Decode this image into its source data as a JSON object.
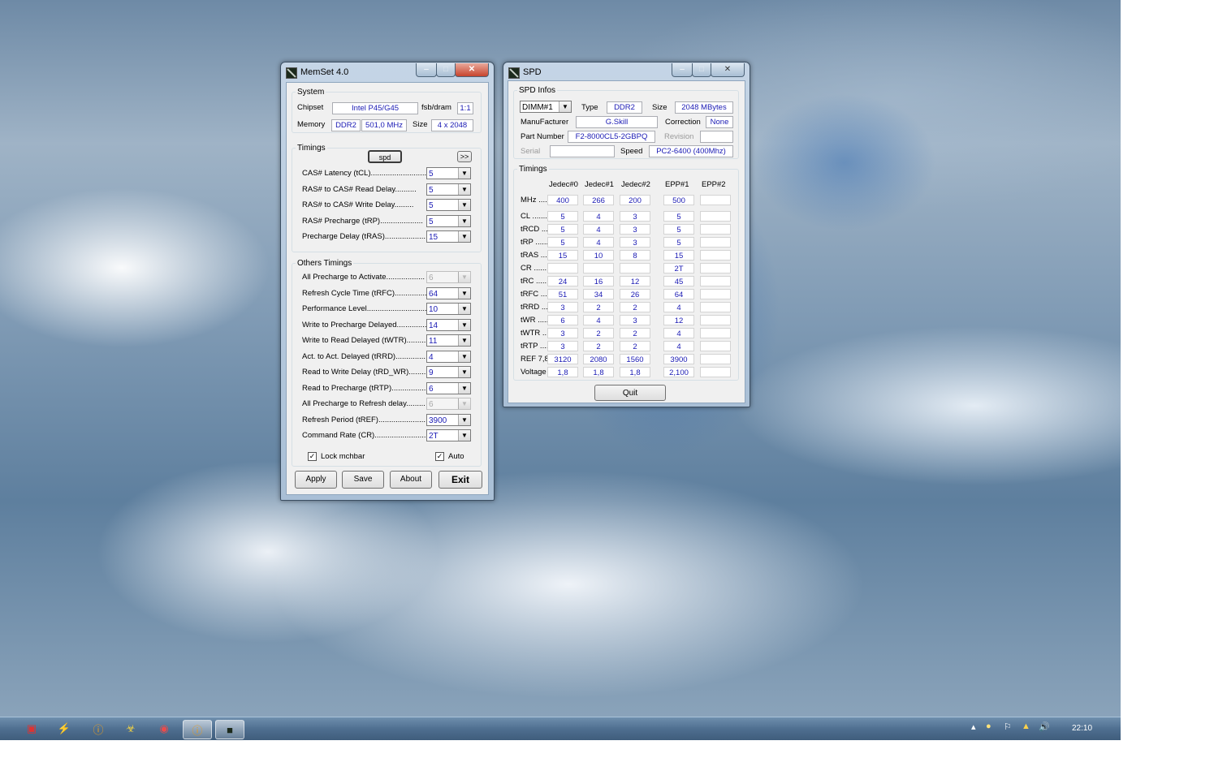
{
  "memset": {
    "title": "MemSet 4.0",
    "system": {
      "legend": "System",
      "chipset_label": "Chipset",
      "chipset_value": "Intel P45/G45",
      "fsbdram_label": "fsb/dram",
      "fsbdram_value": "1:1",
      "memory_label": "Memory",
      "memory_type": "DDR2",
      "memory_freq": "501,0 MHz",
      "size_label": "Size",
      "size_value": "4 x 2048"
    },
    "timings": {
      "legend": "Timings",
      "spd_button": "spd",
      "more_button": ">>",
      "rows": [
        {
          "label": "CAS# Latency (tCL)..........................",
          "value": "5"
        },
        {
          "label": "RAS# to CAS# Read Delay..........",
          "value": "5"
        },
        {
          "label": "RAS# to CAS# Write Delay.........",
          "value": "5"
        },
        {
          "label": "RAS# Precharge (tRP)....................",
          "value": "5"
        },
        {
          "label": "Precharge Delay  (tRAS)...................",
          "value": "15"
        }
      ]
    },
    "others": {
      "legend": "Others Timings",
      "rows": [
        {
          "label": "All Precharge to Activate..................",
          "value": "6",
          "disabled": true
        },
        {
          "label": "Refresh Cycle Time (tRFC)...............",
          "value": "64",
          "disabled": false
        },
        {
          "label": "Performance Level............................",
          "value": "10",
          "disabled": false
        },
        {
          "label": "Write to Precharge Delayed..............",
          "value": "14",
          "disabled": false
        },
        {
          "label": "Write to Read Delayed (tWTR).........",
          "value": "11",
          "disabled": false
        },
        {
          "label": "Act. to Act. Delayed (tRRD)..............",
          "value": "4",
          "disabled": false
        },
        {
          "label": "Read to Write Delay (tRD_WR).........",
          "value": "9",
          "disabled": false
        },
        {
          "label": "Read to Precharge (tRTP)................",
          "value": "6",
          "disabled": false
        },
        {
          "label": "All Precharge to Refresh delay.........",
          "value": "6",
          "disabled": true
        },
        {
          "label": "Refresh Period (tREF)......................",
          "value": "3900",
          "disabled": false
        },
        {
          "label": "Command Rate (CR)..........................",
          "value": "2T",
          "disabled": false
        }
      ],
      "lock_mchbar": "Lock mchbar",
      "auto": "Auto"
    },
    "buttons": {
      "apply": "Apply",
      "save": "Save",
      "about": "About",
      "exit": "Exit"
    }
  },
  "spd": {
    "title": "SPD",
    "infos": {
      "legend": "SPD Infos",
      "dimm": "DIMM#1",
      "type_label": "Type",
      "type_value": "DDR2",
      "size_label": "Size",
      "size_value": "2048 MBytes",
      "manufacturer_label": "ManuFacturer",
      "manufacturer_value": "G.Skill",
      "correction_label": "Correction",
      "correction_value": "None",
      "partnumber_label": "Part Number",
      "partnumber_value": "F2-8000CL5-2GBPQ",
      "revision_label": "Revision",
      "serial_label": "Serial",
      "speed_label": "Speed",
      "speed_value": "PC2-6400 (400Mhz)"
    },
    "timings": {
      "legend": "Timings",
      "columns": [
        "Jedec#0",
        "Jedec#1",
        "Jedec#2",
        "EPP#1",
        "EPP#2"
      ],
      "rows": [
        {
          "label": "MHz .....",
          "values": [
            "400",
            "266",
            "200",
            "500",
            ""
          ]
        },
        {
          "label": "CL .......",
          "values": [
            "5",
            "4",
            "3",
            "5",
            ""
          ]
        },
        {
          "label": "tRCD ....",
          "values": [
            "5",
            "4",
            "3",
            "5",
            ""
          ]
        },
        {
          "label": "tRP ......",
          "values": [
            "5",
            "4",
            "3",
            "5",
            ""
          ]
        },
        {
          "label": "tRAS ....",
          "values": [
            "15",
            "10",
            "8",
            "15",
            ""
          ]
        },
        {
          "label": "CR .......",
          "values": [
            "",
            "",
            "",
            "2T",
            ""
          ]
        },
        {
          "label": "tRC ......",
          "values": [
            "24",
            "16",
            "12",
            "45",
            ""
          ]
        },
        {
          "label": "tRFC ....",
          "values": [
            "51",
            "34",
            "26",
            "64",
            ""
          ]
        },
        {
          "label": "tRRD ...",
          "values": [
            "3",
            "2",
            "2",
            "4",
            ""
          ]
        },
        {
          "label": "tWR .....",
          "values": [
            "6",
            "4",
            "3",
            "12",
            ""
          ]
        },
        {
          "label": "tWTR ...",
          "values": [
            "3",
            "2",
            "2",
            "4",
            ""
          ]
        },
        {
          "label": "tRTP ....",
          "values": [
            "3",
            "2",
            "2",
            "4",
            ""
          ]
        },
        {
          "label": "REF 7,8",
          "values": [
            "3120",
            "2080",
            "1560",
            "3900",
            ""
          ]
        },
        {
          "label": "Voltage",
          "values": [
            "1,8",
            "1,8",
            "1,8",
            "2,100",
            ""
          ]
        }
      ]
    },
    "quit": "Quit"
  },
  "taskbar": {
    "clock": "22:10",
    "icons": [
      "start-icon",
      "app-red-icon",
      "lightning-icon",
      "info-icon",
      "biohazard-icon",
      "browser-icon",
      "info-icon-2",
      "memset-icon"
    ]
  },
  "colors": {
    "value_text": "#1a1ab4",
    "close_button": "#c7432d",
    "taskbar": "#4f6f90"
  }
}
